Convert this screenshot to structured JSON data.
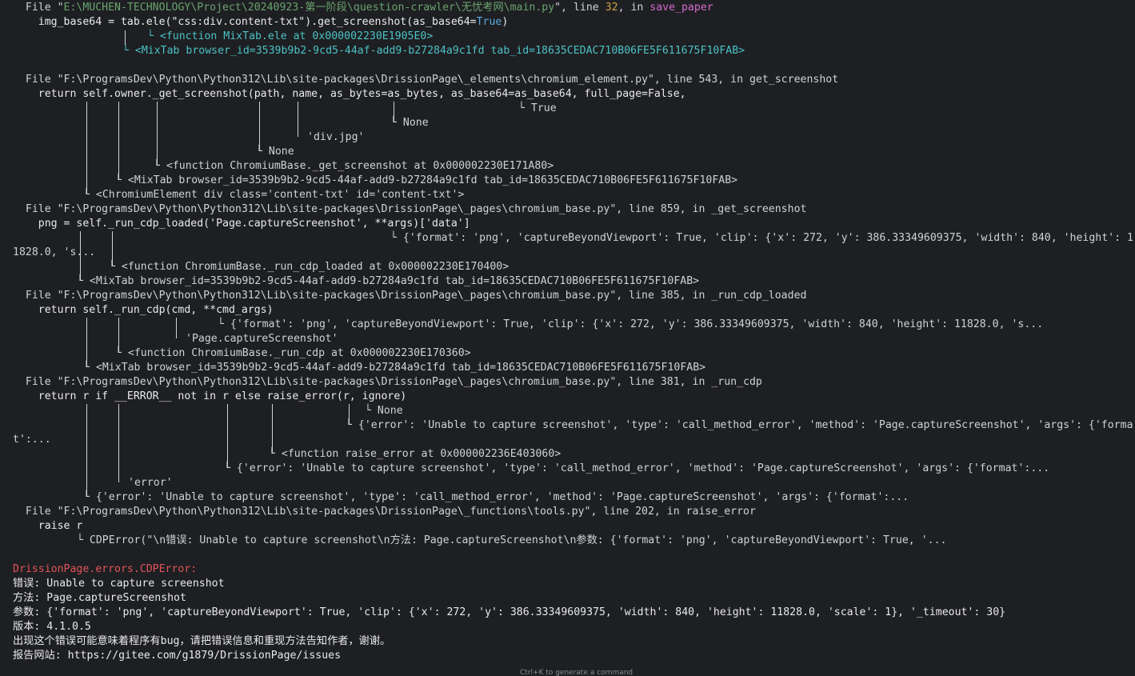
{
  "terminal": {
    "l01": {
      "a": "  File \"",
      "path": "E:\\MUCHEN-TECHNOLOGY\\Project\\20240923-第一阶段\\question-crawler\\无忧考网\\main.py",
      "b": "\", line ",
      "line": "32",
      "c": ", in ",
      "func": "save_paper"
    },
    "l02": {
      "a": "    img_base64 = tab.ele(\"css:div.content-txt\").get_screenshot(as_base64=",
      "kw": "True",
      "b": ")"
    },
    "l03": "└ <function MixTab.ele at 0x000002230E1905E0>",
    "l04": "└ <MixTab browser_id=3539b9b2-9cd5-44af-add9-b27284a9c1fd tab_id=18635CEDAC710B06FE5F611675F10FAB>",
    "l05": "  File \"F:\\ProgramsDev\\Python\\Python312\\Lib\\site-packages\\DrissionPage\\_elements\\chromium_element.py\", line 543, in get_screenshot",
    "l06": "    return self.owner._get_screenshot(path, name, as_bytes=as_bytes, as_base64=as_base64, full_page=False,",
    "l07": "└ True",
    "l08": "└ None",
    "l09": "'div.jpg'",
    "l10": "└ None",
    "l11": "└ <function ChromiumBase._get_screenshot at 0x000002230E171A80>",
    "l12": "└ <MixTab browser_id=3539b9b2-9cd5-44af-add9-b27284a9c1fd tab_id=18635CEDAC710B06FE5F611675F10FAB>",
    "l13": "└ <ChromiumElement div class='content-txt' id='content-txt'>",
    "l14": "  File \"F:\\ProgramsDev\\Python\\Python312\\Lib\\site-packages\\DrissionPage\\_pages\\chromium_base.py\", line 859, in _get_screenshot",
    "l15": "    png = self._run_cdp_loaded('Page.captureScreenshot', **args)['data']",
    "l16": "└ {'format': 'png', 'captureBeyondViewport': True, 'clip': {'x': 272, 'y': 386.33349609375, 'width': 840, 'height': 1",
    "l17": "1828.0, 's...",
    "l18": "└ <function ChromiumBase._run_cdp_loaded at 0x000002230E170400>",
    "l19": "└ <MixTab browser_id=3539b9b2-9cd5-44af-add9-b27284a9c1fd tab_id=18635CEDAC710B06FE5F611675F10FAB>",
    "l20": "  File \"F:\\ProgramsDev\\Python\\Python312\\Lib\\site-packages\\DrissionPage\\_pages\\chromium_base.py\", line 385, in _run_cdp_loaded",
    "l21": "    return self._run_cdp(cmd, **cmd_args)",
    "l22": "└ {'format': 'png', 'captureBeyondViewport': True, 'clip': {'x': 272, 'y': 386.33349609375, 'width': 840, 'height': 11828.0, 's...",
    "l23": "'Page.captureScreenshot'",
    "l24": "└ <function ChromiumBase._run_cdp at 0x000002230E170360>",
    "l25": "└ <MixTab browser_id=3539b9b2-9cd5-44af-add9-b27284a9c1fd tab_id=18635CEDAC710B06FE5F611675F10FAB>",
    "l26": "  File \"F:\\ProgramsDev\\Python\\Python312\\Lib\\site-packages\\DrissionPage\\_pages\\chromium_base.py\", line 381, in _run_cdp",
    "l27": "    return r if __ERROR__ not in r else raise_error(r, ignore)",
    "l28": "└ None",
    "l29": "└ {'error': 'Unable to capture screenshot', 'type': 'call_method_error', 'method': 'Page.captureScreenshot', 'args': {'forma",
    "l30": "t':...",
    "l31": "└ <function raise_error at 0x000002236E403060>",
    "l32": "└ {'error': 'Unable to capture screenshot', 'type': 'call_method_error', 'method': 'Page.captureScreenshot', 'args': {'format':...",
    "l33": "'error'",
    "l34": "└ {'error': 'Unable to capture screenshot', 'type': 'call_method_error', 'method': 'Page.captureScreenshot', 'args': {'format':...",
    "l35": "  File \"F:\\ProgramsDev\\Python\\Python312\\Lib\\site-packages\\DrissionPage\\_functions\\tools.py\", line 202, in raise_error",
    "l36": "    raise r",
    "l37": "└ CDPError(\"\\n错误: Unable to capture screenshot\\n方法: Page.captureScreenshot\\n参数: {'format': 'png', 'captureBeyondViewport': True, '...",
    "l38": "DrissionPage.errors.CDPError:",
    "l39": "错误: Unable to capture screenshot",
    "l40": "方法: Page.captureScreenshot",
    "l41": "参数: {'format': 'png', 'captureBeyondViewport': True, 'clip': {'x': 272, 'y': 386.33349609375, 'width': 840, 'height': 11828.0, 'scale': 1}, '_timeout': 30}",
    "l42": "版本: 4.1.0.5",
    "l43": "出现这个错误可能意味着程序有bug，请把错误信息和重现方法告知作者，谢谢。",
    "l44": "报告网站: https://gitee.com/g1879/DrissionPage/issues"
  },
  "footer": {
    "hint": "Ctrl+K to generate a command"
  },
  "colors": {
    "background": "#1e1f22",
    "text": "#cfd2d6",
    "path": "#6aa36f",
    "number": "#d0a14a",
    "function": "#d46ad0",
    "keyword": "#5aa8e0",
    "cyan": "#4cc2c6",
    "error": "#e0555a"
  }
}
